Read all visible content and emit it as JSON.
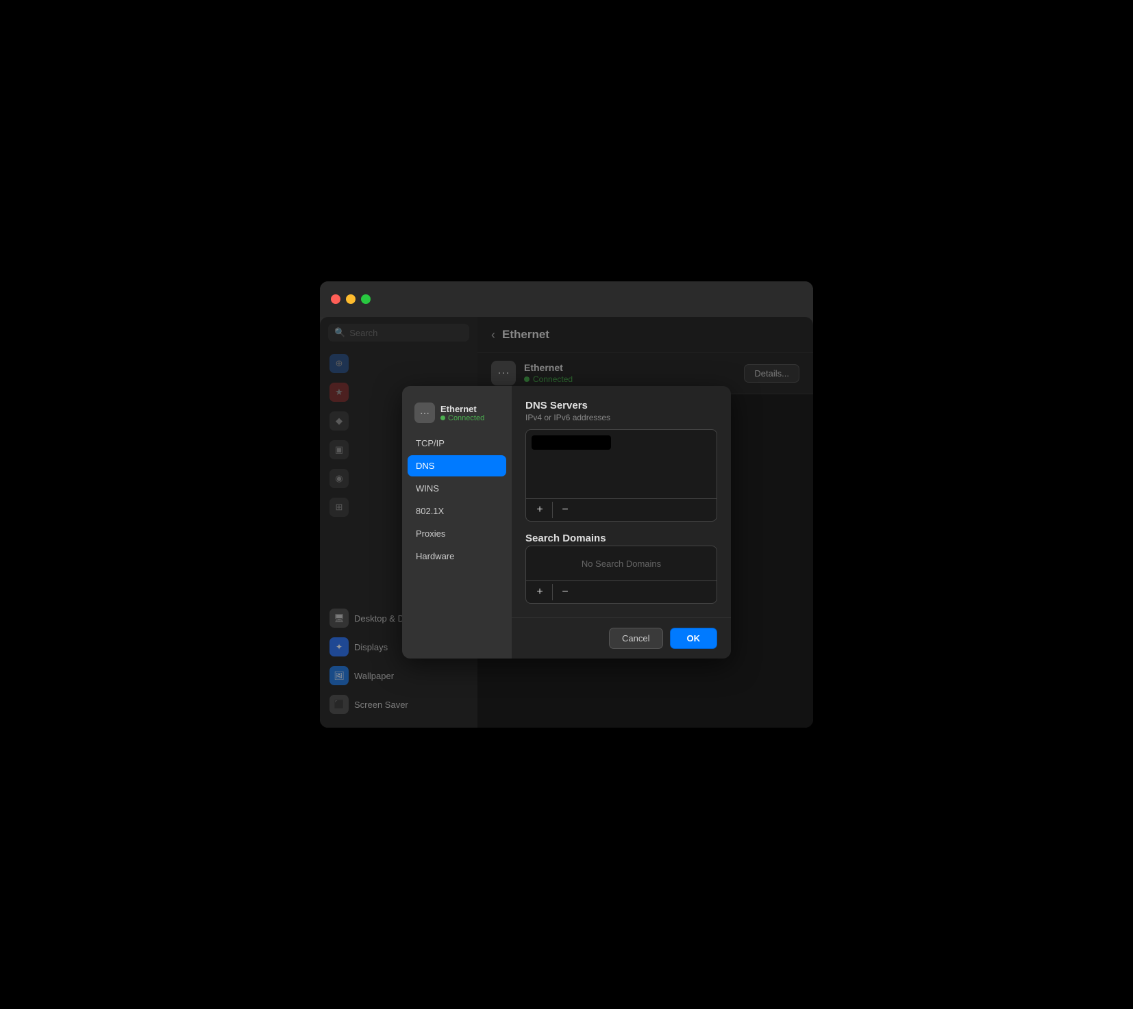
{
  "window": {
    "title": "Ethernet"
  },
  "trafficLights": {
    "close": "close",
    "minimize": "minimize",
    "maximize": "maximize"
  },
  "sidebar": {
    "search_placeholder": "Search",
    "bottom_items": [
      {
        "id": "desktop-dock",
        "label": "Desktop & Dock",
        "icon": "🖥",
        "color": "#555"
      },
      {
        "id": "displays",
        "label": "Displays",
        "icon": "✦",
        "color": "#3478f6"
      },
      {
        "id": "wallpaper",
        "label": "Wallpaper",
        "icon": "🖼",
        "color": "#2a7de1"
      },
      {
        "id": "screen-saver",
        "label": "Screen Saver",
        "icon": "⬛",
        "color": "#555"
      }
    ]
  },
  "detailHeader": {
    "back_label": "‹",
    "title": "Ethernet"
  },
  "networkStatus": {
    "name": "Ethernet",
    "status": "Connected",
    "details_button": "Details..."
  },
  "dialog": {
    "nav": {
      "device_name": "Ethernet",
      "device_status": "Connected",
      "items": [
        {
          "id": "tcpip",
          "label": "TCP/IP",
          "active": false
        },
        {
          "id": "dns",
          "label": "DNS",
          "active": true
        },
        {
          "id": "wins",
          "label": "WINS",
          "active": false
        },
        {
          "id": "8021x",
          "label": "802.1X",
          "active": false
        },
        {
          "id": "proxies",
          "label": "Proxies",
          "active": false
        },
        {
          "id": "hardware",
          "label": "Hardware",
          "active": false
        }
      ]
    },
    "dns_section": {
      "title": "DNS Servers",
      "subtitle": "IPv4 or IPv6 addresses",
      "entries": [
        "(redacted)"
      ],
      "add_button": "+",
      "remove_button": "−"
    },
    "search_domains_section": {
      "title": "Search Domains",
      "empty_text": "No Search Domains",
      "add_button": "+",
      "remove_button": "−"
    },
    "footer": {
      "cancel_label": "Cancel",
      "ok_label": "OK"
    }
  }
}
